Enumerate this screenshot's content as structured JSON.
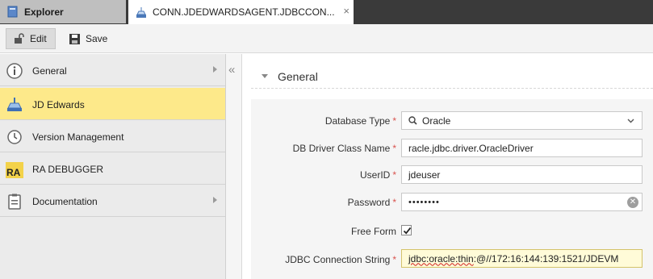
{
  "tabs": [
    {
      "label": "Explorer",
      "icon": "explorer-icon"
    },
    {
      "label": "CONN.JDEDWARDSAGENT.JDBCCON...",
      "icon": "connection-icon",
      "close": "×"
    }
  ],
  "toolbar": {
    "edit_label": "Edit",
    "save_label": "Save"
  },
  "sidebar": {
    "items": [
      {
        "label": "General",
        "icon": "info-icon",
        "has_arrow": true,
        "active": false
      },
      {
        "label": "JD Edwards",
        "icon": "jd-edwards-icon",
        "has_arrow": false,
        "active": true
      },
      {
        "label": "Version Management",
        "icon": "history-icon",
        "has_arrow": false,
        "active": false
      },
      {
        "label": "RA DEBUGGER",
        "icon": "ra-debugger-icon",
        "icon_text": "RA",
        "has_arrow": false,
        "active": false
      },
      {
        "label": "Documentation",
        "icon": "clipboard-icon",
        "has_arrow": true,
        "active": false
      }
    ],
    "collapse_glyph": "«"
  },
  "section": {
    "title": "General"
  },
  "form": {
    "database_type": {
      "label": "Database Type",
      "value": "Oracle"
    },
    "driver_class": {
      "label": "DB Driver Class Name",
      "value": "racle.jdbc.driver.OracleDriver"
    },
    "user_id": {
      "label": "UserID",
      "value": "jdeuser"
    },
    "password": {
      "label": "Password",
      "value": "••••••••"
    },
    "free_form": {
      "label": "Free Form",
      "checked": true
    },
    "jdbc_string": {
      "label": "JDBC Connection String",
      "value_underlined": "jdbc:oracle:thin",
      "value_rest": ":@//172:16:144:139:1521/JDEVM"
    },
    "required_marker": "*"
  },
  "colors": {
    "active_item": "#fde98a",
    "required": "#d9534f",
    "tabbar": "#3a3a3a"
  }
}
